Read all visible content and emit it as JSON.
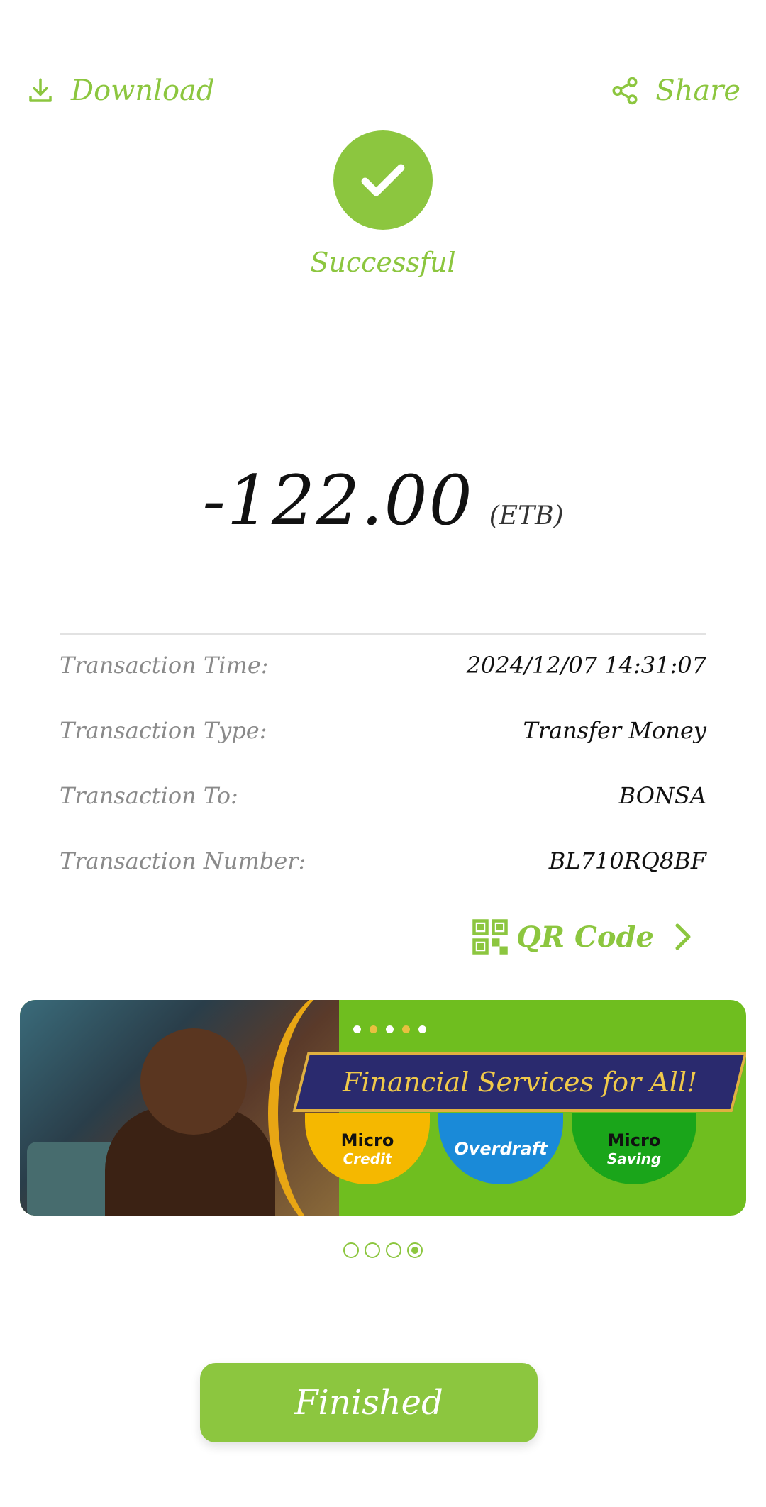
{
  "header": {
    "download_label": "Download",
    "share_label": "Share"
  },
  "status": {
    "text": "Successful",
    "color": "#8cc63f"
  },
  "amount": {
    "value": "-122.00",
    "currency": "(ETB)"
  },
  "details": [
    {
      "label": "Transaction Time:",
      "value": "2024/12/07 14:31:07"
    },
    {
      "label": "Transaction Type:",
      "value": "Transfer Money"
    },
    {
      "label": "Transaction To:",
      "value": "BONSA"
    },
    {
      "label": "Transaction Number:",
      "value": "BL710RQ8BF"
    }
  ],
  "qr": {
    "label": "QR Code"
  },
  "banner": {
    "headline": "Financial Services for All!",
    "items": [
      {
        "line1": "Micro",
        "line2": "Credit"
      },
      {
        "line1": "Overdraft",
        "line2": ""
      },
      {
        "line1": "Micro",
        "line2": "Saving"
      }
    ],
    "pager": {
      "total": 4,
      "active": 4
    }
  },
  "footer": {
    "finished_label": "Finished"
  }
}
